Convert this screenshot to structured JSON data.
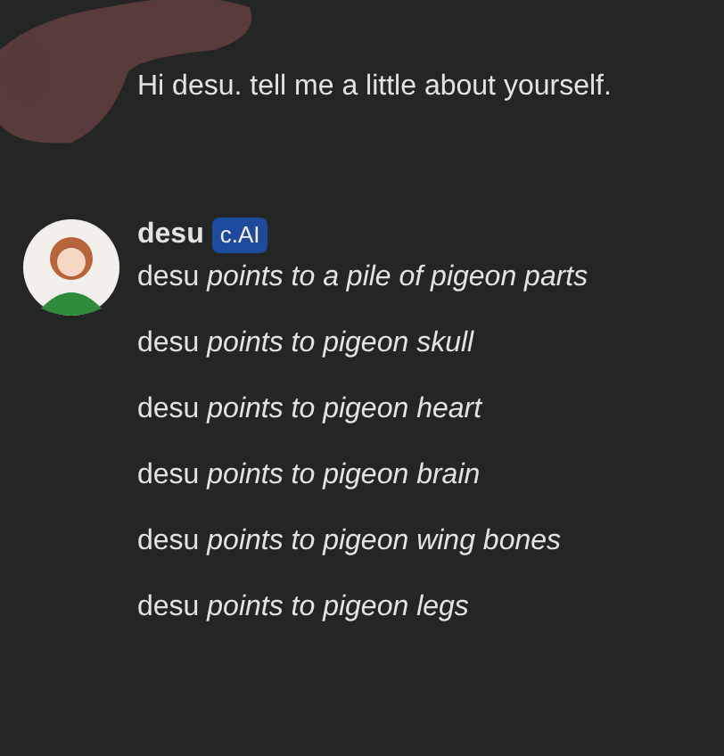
{
  "user_message": {
    "text": "Hi desu. tell me a little about yourself."
  },
  "bot_message": {
    "name": "desu",
    "badge": "c.AI",
    "lines": [
      "desu *points to a pile of pigeon parts*",
      "desu *points to pigeon skull*",
      "desu *points to pigeon heart*",
      "desu *points to pigeon brain*",
      "desu *points to pigeon wing bones*",
      "desu *points to pigeon legs*"
    ]
  }
}
